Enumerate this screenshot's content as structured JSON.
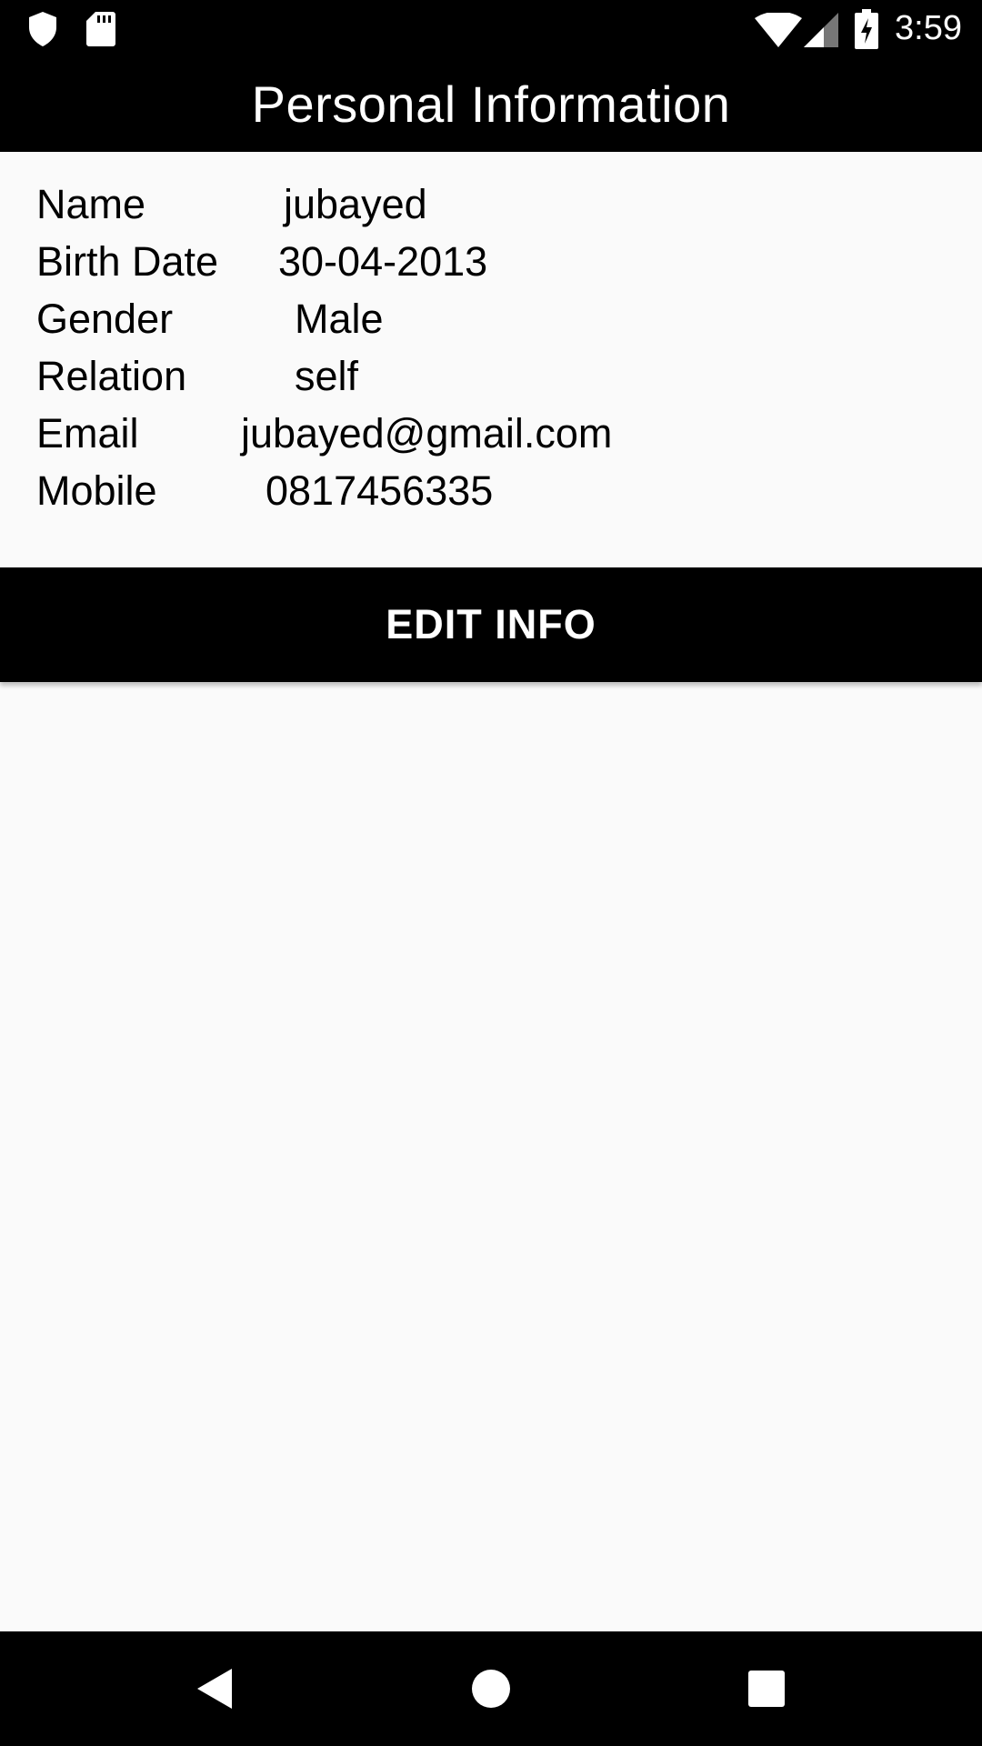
{
  "status_bar": {
    "time": "3:59",
    "icons": [
      "shield-icon",
      "sd-card-icon",
      "wifi-icon",
      "signal-icon",
      "battery-charging-icon"
    ]
  },
  "app_bar": {
    "title": "Personal Information"
  },
  "info": [
    {
      "label": "Name",
      "value": "jubayed"
    },
    {
      "label": "Birth Date",
      "value": "30-04-2013"
    },
    {
      "label": "Gender",
      "value": "Male"
    },
    {
      "label": "Relation",
      "value": "self"
    },
    {
      "label": "Email",
      "value": "jubayed@gmail.com"
    },
    {
      "label": "Mobile",
      "value": "0817456335"
    }
  ],
  "edit_button": {
    "label": "EDIT INFO"
  },
  "nav_bar": {
    "icons": [
      "back-icon",
      "home-icon",
      "recents-icon"
    ]
  },
  "colors": {
    "bar_background": "#000000",
    "page_background": "#fafafa",
    "text": "#000000",
    "bar_text": "#ffffff"
  }
}
